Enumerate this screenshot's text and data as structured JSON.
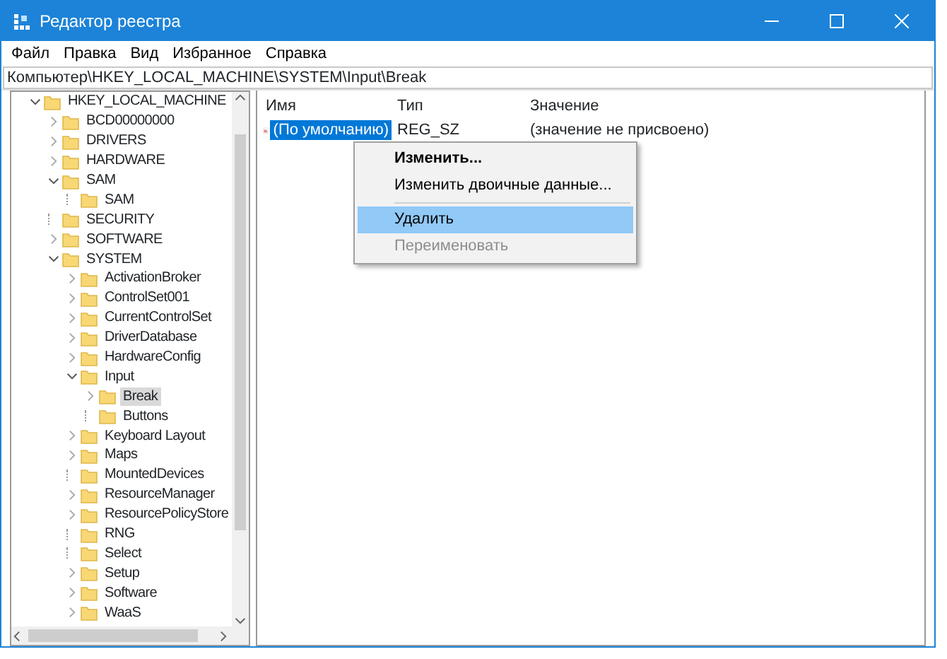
{
  "window": {
    "title": "Редактор реестра"
  },
  "menu_bar": [
    "Файл",
    "Правка",
    "Вид",
    "Избранное",
    "Справка"
  ],
  "address": "Компьютер\\HKEY_LOCAL_MACHINE\\SYSTEM\\Input\\Break",
  "tree": [
    {
      "label": "HKEY_LOCAL_MACHINE",
      "expanded": true,
      "selected": false,
      "children": [
        {
          "label": "BCD00000000",
          "expanded": false,
          "selected": false
        },
        {
          "label": "DRIVERS",
          "expanded": false,
          "selected": false
        },
        {
          "label": "HARDWARE",
          "expanded": false,
          "selected": false
        },
        {
          "label": "SAM",
          "expanded": true,
          "selected": false,
          "children": [
            {
              "label": "SAM",
              "selected": false
            }
          ]
        },
        {
          "label": "SECURITY",
          "selected": false
        },
        {
          "label": "SOFTWARE",
          "expanded": false,
          "selected": false
        },
        {
          "label": "SYSTEM",
          "expanded": true,
          "selected": false,
          "children": [
            {
              "label": "ActivationBroker",
              "expanded": false,
              "selected": false
            },
            {
              "label": "ControlSet001",
              "expanded": false,
              "selected": false
            },
            {
              "label": "CurrentControlSet",
              "expanded": false,
              "selected": false
            },
            {
              "label": "DriverDatabase",
              "expanded": false,
              "selected": false
            },
            {
              "label": "HardwareConfig",
              "expanded": false,
              "selected": false
            },
            {
              "label": "Input",
              "expanded": true,
              "selected": false,
              "children": [
                {
                  "label": "Break",
                  "expanded": false,
                  "selected": true
                },
                {
                  "label": "Buttons",
                  "selected": false
                }
              ]
            },
            {
              "label": "Keyboard Layout",
              "expanded": false,
              "selected": false
            },
            {
              "label": "Maps",
              "expanded": false,
              "selected": false
            },
            {
              "label": "MountedDevices",
              "selected": false
            },
            {
              "label": "ResourceManager",
              "expanded": false,
              "selected": false
            },
            {
              "label": "ResourcePolicyStore",
              "expanded": false,
              "selected": false
            },
            {
              "label": "RNG",
              "selected": false
            },
            {
              "label": "Select",
              "selected": false
            },
            {
              "label": "Setup",
              "expanded": false,
              "selected": false
            },
            {
              "label": "Software",
              "expanded": false,
              "selected": false
            },
            {
              "label": "WaaS",
              "expanded": false,
              "selected": false
            }
          ]
        }
      ]
    }
  ],
  "values": {
    "columns": [
      "Имя",
      "Тип",
      "Значение"
    ],
    "rows": [
      {
        "name": "(По умолчанию)",
        "type": "REG_SZ",
        "data": "(значение не присвоено)",
        "selected": true
      }
    ]
  },
  "context_menu": [
    {
      "kind": "item",
      "label": "Изменить...",
      "default": true,
      "disabled": false,
      "selected": false
    },
    {
      "kind": "item",
      "label": "Изменить двоичные данные...",
      "default": false,
      "disabled": false,
      "selected": false
    },
    {
      "kind": "separator"
    },
    {
      "kind": "item",
      "label": "Удалить",
      "default": false,
      "disabled": false,
      "selected": true
    },
    {
      "kind": "item",
      "label": "Переименовать",
      "default": false,
      "disabled": true,
      "selected": false
    }
  ]
}
